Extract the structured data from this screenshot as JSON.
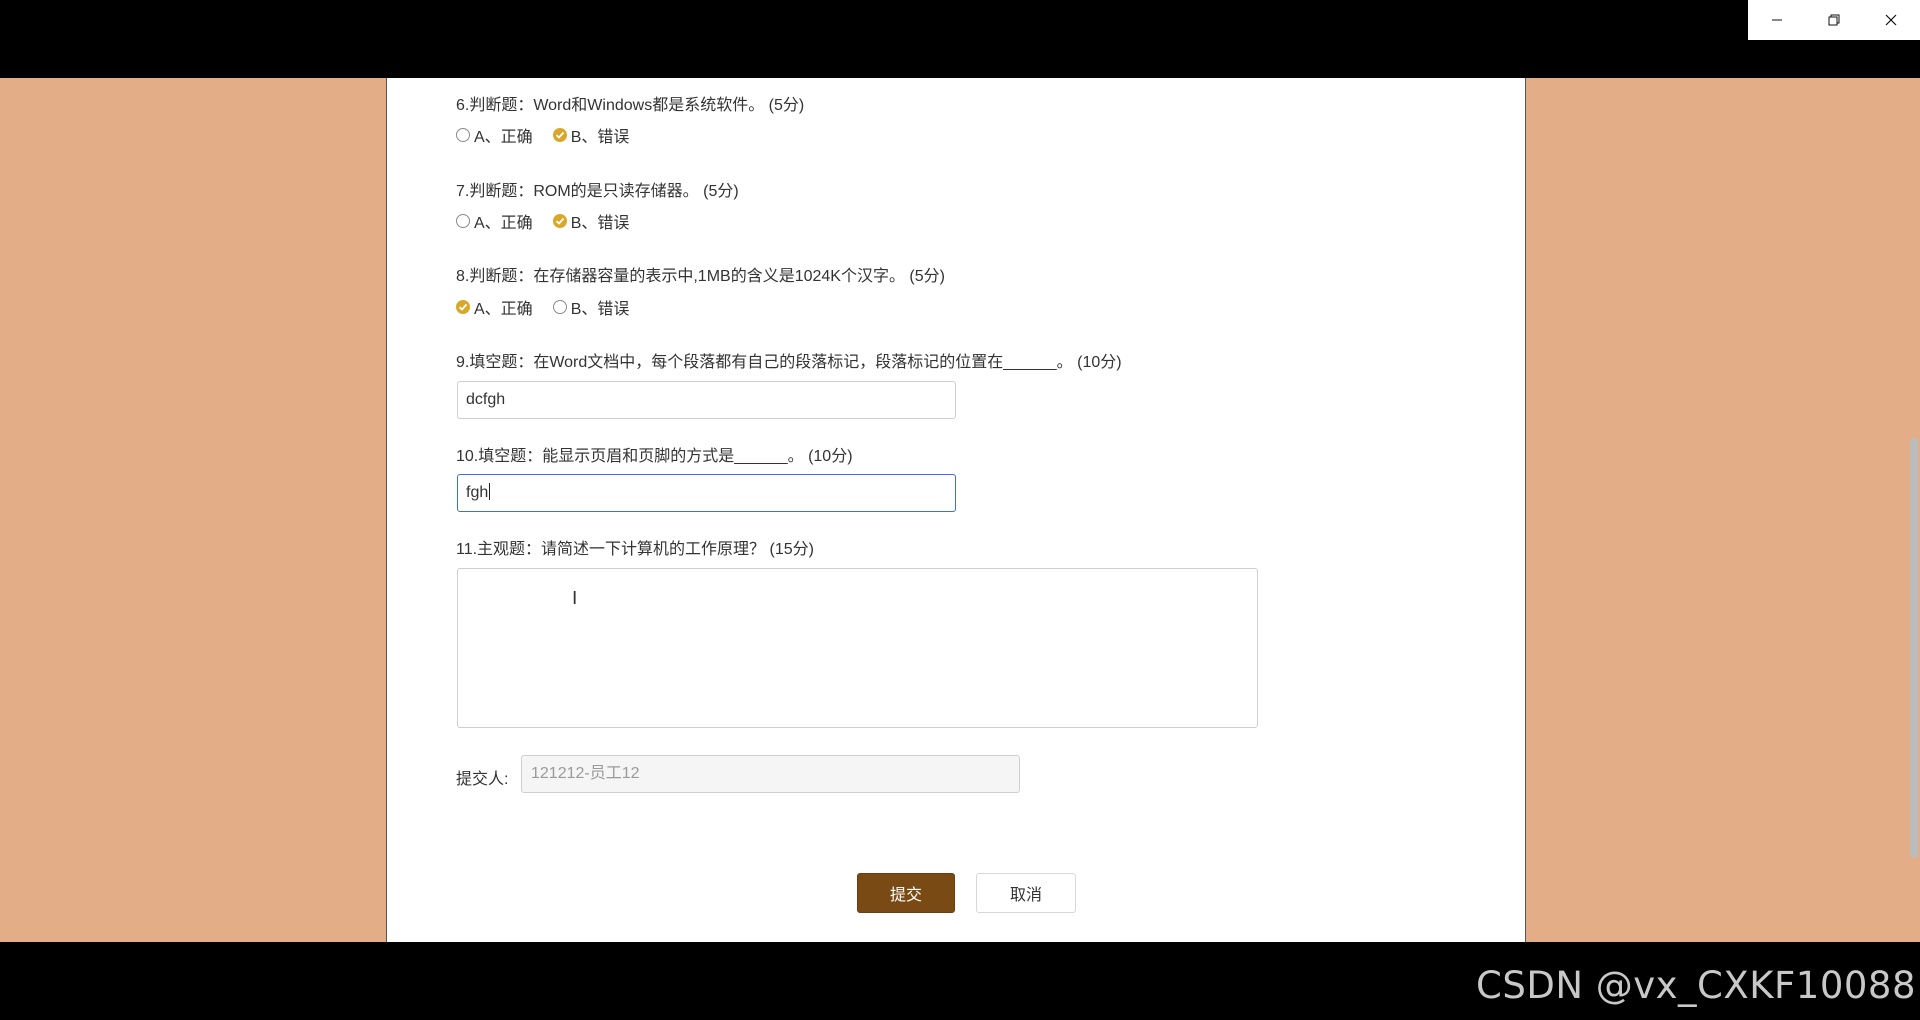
{
  "window": {
    "controls": [
      {
        "name": "minimize",
        "icon": "minimize-icon"
      },
      {
        "name": "restore",
        "icon": "restore-icon"
      },
      {
        "name": "close",
        "icon": "close-icon"
      }
    ]
  },
  "questions": {
    "q6": {
      "title": "6.判断题：Word和Windows都是系统软件。 (5分)",
      "options": [
        "A、正确",
        "B、错误"
      ],
      "selected": "B"
    },
    "q7": {
      "title": "7.判断题：ROM的是只读存储器。 (5分)",
      "options": [
        "A、正确",
        "B、错误"
      ],
      "selected": "B"
    },
    "q8": {
      "title": "8.判断题：在存储器容量的表示中,1MB的含义是1024K个汉字。 (5分)",
      "options": [
        "A、正确",
        "B、错误"
      ],
      "selected": "A"
    },
    "q9": {
      "title": "9.填空题：在Word文档中，每个段落都有自己的段落标记，段落标记的位置在______。 (10分)",
      "value": "dcfgh"
    },
    "q10": {
      "title": "10.填空题：能显示页眉和页脚的方式是______。 (10分)",
      "value": "fgh"
    },
    "q11": {
      "title": "11.主观题：请简述一下计算机的工作原理？ (15分)",
      "value": ""
    }
  },
  "submitter": {
    "label": "提交人:",
    "value": "121212-员工12"
  },
  "actions": {
    "submit_label": "提交",
    "cancel_label": "取消"
  },
  "watermark": "CSDN @vx_CXKF10088",
  "colors": {
    "page_background": "#e3ae87",
    "submit_button": "#7a4a14",
    "radio_checked": "#d9a72a",
    "focus_border": "#3c6ee0"
  }
}
